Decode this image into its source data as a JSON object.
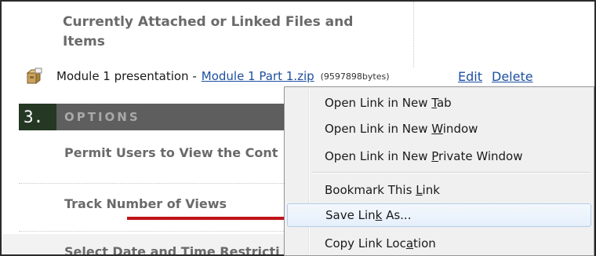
{
  "attached": {
    "heading": "Currently Attached or Linked Files and Items",
    "file_label": "Module 1 presentation -",
    "file_link": "Module 1 Part 1.zip",
    "file_size": "(9597898bytes)",
    "edit_label": "Edit",
    "delete_label": "Delete",
    "file_icon": "package-icon"
  },
  "options": {
    "number": "3.",
    "title": "OPTIONS",
    "items": [
      "Permit Users to View the Cont",
      "Track Number of Views",
      "Select Date and Time Restricti"
    ]
  },
  "context_menu": {
    "items": [
      {
        "before": "Open Link in New ",
        "key": "T",
        "after": "ab"
      },
      {
        "before": "Open Link in New ",
        "key": "W",
        "after": "indow"
      },
      {
        "before": "Open Link in New ",
        "key": "P",
        "after": "rivate Window"
      },
      {
        "before": "Bookmark This ",
        "key": "L",
        "after": "ink"
      },
      {
        "before": "Save Lin",
        "key": "k",
        "after": " As..."
      },
      {
        "before": "Copy Link Loc",
        "key": "a",
        "after": "tion"
      }
    ],
    "highlighted_index": 4
  },
  "colors": {
    "link": "#1c4fa0",
    "options_bar": "#5e5e5e",
    "options_number_bg": "#243824",
    "annotation_arrow": "#c0141b"
  }
}
